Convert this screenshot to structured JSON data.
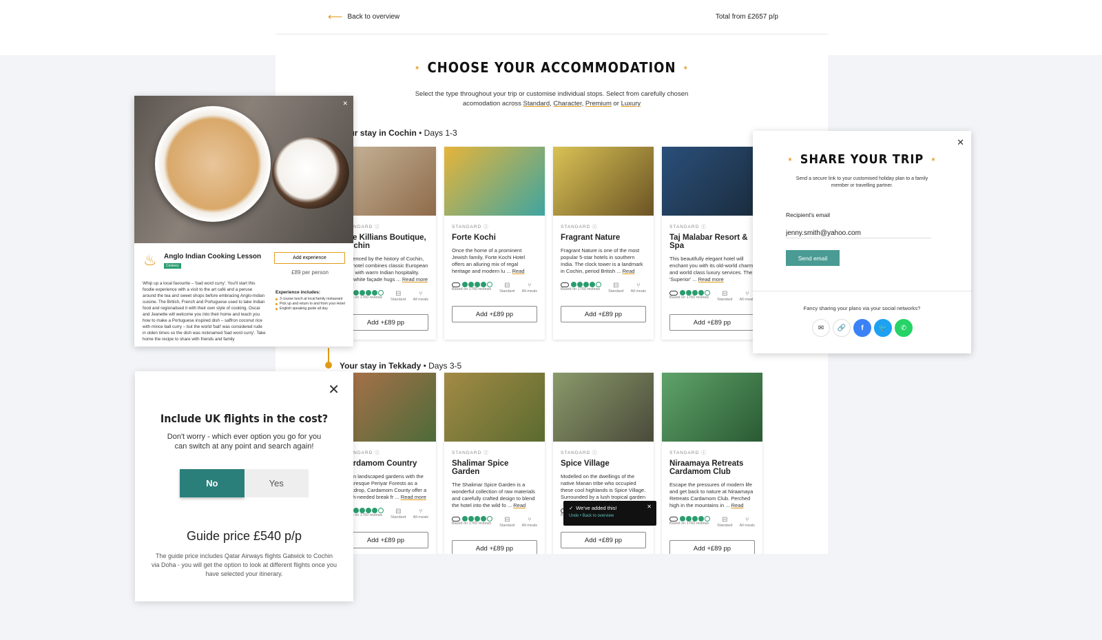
{
  "topbar": {
    "back_label": "Back to overview",
    "total": "Total from £2657 p/p"
  },
  "page": {
    "title": "CHOOSE YOUR ACCOMMODATION",
    "intro_text": "Select the type throughout your trip or customise individual stops. Select from carefully chosen acomodation across",
    "types": [
      "Standard",
      "Character",
      "Premium",
      "Luxury"
    ],
    "or_word": "or"
  },
  "stays": [
    {
      "title": "Your stay in Cochin",
      "days": "• Days 1-3",
      "hotels": [
        {
          "category": "STANDARD",
          "name": "The Killians Boutique, Cochin",
          "desc": "Influenced by the history of Cochin, this hotel combines classic European style with warm Indian hospitality. The white façade hugs",
          "img": [
            "#c9b79c",
            "#8e6b4a"
          ]
        },
        {
          "category": "STANDARD",
          "name": "Forte Kochi",
          "desc": "Once the home of a prominent Jewish family, Forte Kochi Hotel offers an alluring mix of regal heritage and modern lu",
          "img": [
            "#e6b43a",
            "#3fa5a0"
          ]
        },
        {
          "category": "STANDARD",
          "name": "Fragrant Nature",
          "desc": "Fragrant Nature is one of the most popular 5-star hotels in southern India. The clock tower is a landmark in Cochin, period British",
          "img": [
            "#d9c255",
            "#6b5424"
          ]
        },
        {
          "category": "STANDARD",
          "name": "Taj Malabar Resort & Spa",
          "desc": "This beautifully elegant hotel will enchant you with its old-world charm and world class luxury services. The 'Superior'",
          "img": [
            "#2a4f7a",
            "#1a2b3c"
          ]
        }
      ]
    },
    {
      "title": "Your stay in Tekkady",
      "days": "• Days 3-5",
      "hotels": [
        {
          "category": "STANDARD",
          "name": "Cardamom Country",
          "desc": "Set in landscaped gardens with the picturesque Periyar Forests as a backdrop, Cardamom County offer a much-needed break fr",
          "img": [
            "#b0714a",
            "#4d6b39"
          ]
        },
        {
          "category": "STANDARD",
          "name": "Shalimar Spice Garden",
          "desc": "The Shalimar Spice Garden is a wonderful collection of raw materials and carefully crafted design to blend the hotel into the wild fo",
          "img": [
            "#a28a45",
            "#5b6b2f"
          ]
        },
        {
          "category": "STANDARD",
          "name": "Spice Village",
          "desc": "Modelled on the dwellings of the native Manan tribe who occupied these cool highlands is Spice Village. Surrounded by a lush tropical garden",
          "img": [
            "#8a9a6a",
            "#4a4a3a"
          ]
        },
        {
          "category": "STANDARD",
          "name": "Niraamaya Retreats Cardamom Club",
          "desc": "Escape the pressures of modern life and get back to nature at Niraamaya Retreats Cardamom Club. Perched high in the mountains in",
          "img": [
            "#5fa36a",
            "#2a5a33"
          ]
        }
      ]
    }
  ],
  "card_common": {
    "read_more": "Read more",
    "reviews": "Based on 1760 reviews",
    "room": "Standard",
    "meals": "All meals",
    "add_label": "Add +£89 pp",
    "rating": 4
  },
  "experience": {
    "name": "Anglo Indian Cooking Lesson",
    "tag": "Cookery",
    "add_label": "Add experience",
    "price": "£89 per person",
    "body": "Whip up a local favourite – 'bad word curry'. You'll start this foodie experience with a visit to the art café and a peruse around the tea and sweet shops before embracing Anglo-Indian cuisine. The British, French and Portuguese used to take Indian food and regionalised it with their own style of cooking. Oscar and Jeanette will welcome you into their home and teach you how to make a Portuguese inspired dish – saffron coconut rice with mince ball curry – but the world 'ball' was considered rude in olden times so the dish was nicknamed 'bad word curry'. Take home the recipe to share with friends and family",
    "includes_title": "Experience includes:",
    "includes": [
      "3 course lunch at local family restaurant",
      "Pick up and return to and from your Hotel",
      "English speaking guide all day"
    ]
  },
  "flights": {
    "title": "Include UK flights in the cost?",
    "subtitle": "Don't worry - which ever option you go for you can switch at any point and search again!",
    "no_label": "No",
    "yes_label": "Yes",
    "guide_price": "Guide price £540 p/p",
    "guide_text": "The guide price includes Qatar Airways flights Gatwick to Cochin via Doha - you will get the option to look at different flights once you have selected your itinerary."
  },
  "share": {
    "title": "SHARE YOUR TRIP",
    "desc": "Send a secure link to your customised holiday plan to a family member or travelling partner.",
    "email_label": "Recipient's email",
    "email_value": "jenny.smith@yahoo.com",
    "send_label": "Send email",
    "social_text": "Fancy sharing your plans via your social networks?"
  },
  "toast": {
    "message": "We've added this!",
    "undo": "Undo",
    "back": "Back to overview"
  },
  "colors": {
    "accent": "#e29a16",
    "teal": "#2a7f7a",
    "tripadvisor": "#2a9d6e"
  }
}
